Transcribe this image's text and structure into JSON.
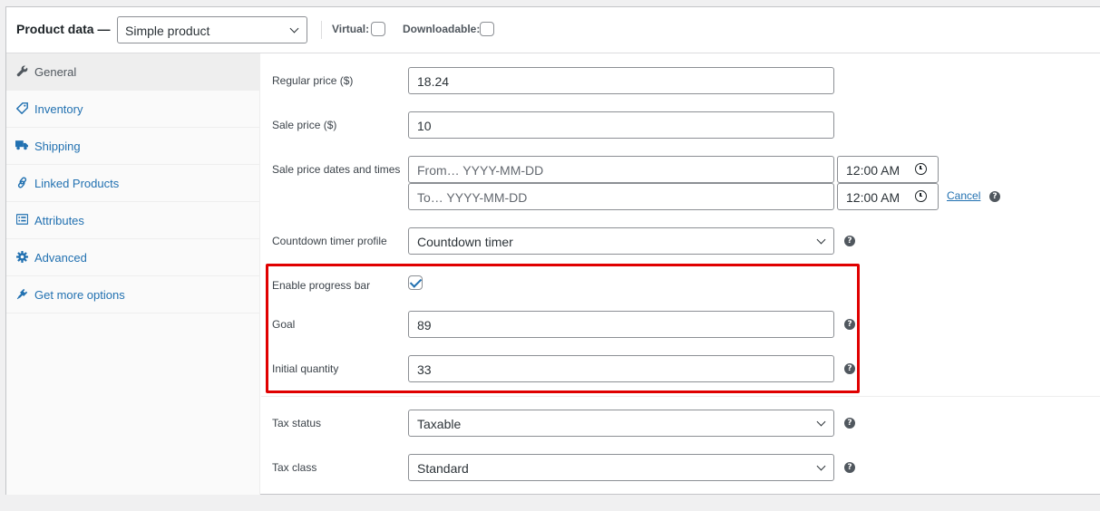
{
  "header": {
    "title": "Product data —",
    "product_type": "Simple product",
    "virtual_label": "Virtual:",
    "downloadable_label": "Downloadable:"
  },
  "sidebar": {
    "items": [
      {
        "label": "General",
        "icon": "wrench-icon",
        "active": true
      },
      {
        "label": "Inventory",
        "icon": "tag-icon"
      },
      {
        "label": "Shipping",
        "icon": "truck-icon"
      },
      {
        "label": "Linked Products",
        "icon": "link-icon"
      },
      {
        "label": "Attributes",
        "icon": "list-icon"
      },
      {
        "label": "Advanced",
        "icon": "gear-icon"
      },
      {
        "label": "Get more options",
        "icon": "plugin-icon"
      }
    ]
  },
  "general": {
    "regular_price": {
      "label": "Regular price ($)",
      "value": "18.24"
    },
    "sale_price": {
      "label": "Sale price ($)",
      "value": "10"
    },
    "sale_dates": {
      "label": "Sale price dates and times",
      "from_placeholder": "From… YYYY-MM-DD",
      "to_placeholder": "To…  YYYY-MM-DD",
      "from_time": "12:00  AM",
      "to_time": "12:00  AM",
      "cancel": "Cancel"
    },
    "countdown": {
      "label": "Countdown timer profile",
      "value": "Countdown timer"
    },
    "progress_bar": {
      "label": "Enable progress bar",
      "checked": true
    },
    "goal": {
      "label": "Goal",
      "value": "89"
    },
    "initial_quantity": {
      "label": "Initial quantity",
      "value": "33"
    },
    "tax_status": {
      "label": "Tax status",
      "value": "Taxable"
    },
    "tax_class": {
      "label": "Tax class",
      "value": "Standard"
    }
  },
  "help_glyph": "?",
  "colors": {
    "link": "#2271b1",
    "highlight": "#e00000",
    "border": "#8c8f94"
  }
}
